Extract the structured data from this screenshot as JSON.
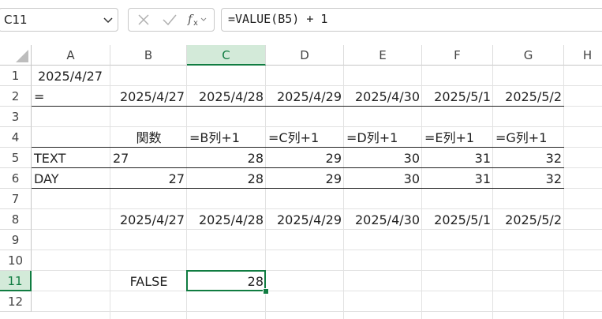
{
  "formula_bar": {
    "name_box": "C11",
    "formula": "=VALUE(B5) + 1"
  },
  "columns": [
    "A",
    "B",
    "C",
    "D",
    "E",
    "F",
    "G",
    "H"
  ],
  "rows": [
    "1",
    "2",
    "3",
    "4",
    "5",
    "6",
    "7",
    "8",
    "9",
    "10",
    "11",
    "12"
  ],
  "selected_cell": "C11",
  "cells": {
    "A1": "2025/4/27",
    "A2": "=",
    "B2": "2025/4/27",
    "C2": "2025/4/28",
    "D2": "2025/4/29",
    "E2": "2025/4/30",
    "F2": "2025/5/1",
    "G2": "2025/5/2",
    "B4": "関数",
    "C4": "=B列+1",
    "D4": "=C列+1",
    "E4": "=D列+1",
    "F4": "=E列+1",
    "G4": "=G列+1",
    "A5": "TEXT",
    "B5": "27",
    "C5": "28",
    "D5": "29",
    "E5": "30",
    "F5": "31",
    "G5": "32",
    "A6": "DAY",
    "B6": "27",
    "C6": "28",
    "D6": "29",
    "E6": "30",
    "F6": "31",
    "G6": "32",
    "B8": "2025/4/27",
    "C8": "2025/4/28",
    "D8": "2025/4/29",
    "E8": "2025/4/30",
    "F8": "2025/5/1",
    "G8": "2025/5/2",
    "B11": "FALSE",
    "C11": "28"
  },
  "colors": {
    "accent": "#107c41",
    "selected_header_bg": "#d3ead9"
  },
  "icons": [
    "chevron-down-icon",
    "cancel-icon",
    "enter-check-icon",
    "insert-function-icon"
  ]
}
